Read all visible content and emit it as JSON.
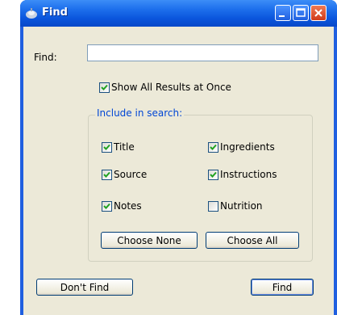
{
  "window": {
    "title": "Find"
  },
  "find": {
    "label": "Find:",
    "value": ""
  },
  "show_all": {
    "label": "Show All Results at Once",
    "checked": true
  },
  "include": {
    "legend": "Include in search:",
    "items": [
      {
        "label": "Title",
        "checked": true
      },
      {
        "label": "Ingredients",
        "checked": true
      },
      {
        "label": "Source",
        "checked": true
      },
      {
        "label": "Instructions",
        "checked": true
      },
      {
        "label": "Notes",
        "checked": true
      },
      {
        "label": "Nutrition",
        "checked": false
      }
    ],
    "choose_none_label": "Choose None",
    "choose_all_label": "Choose All"
  },
  "buttons": {
    "dont_find_label": "Don't Find",
    "find_label": "Find"
  }
}
